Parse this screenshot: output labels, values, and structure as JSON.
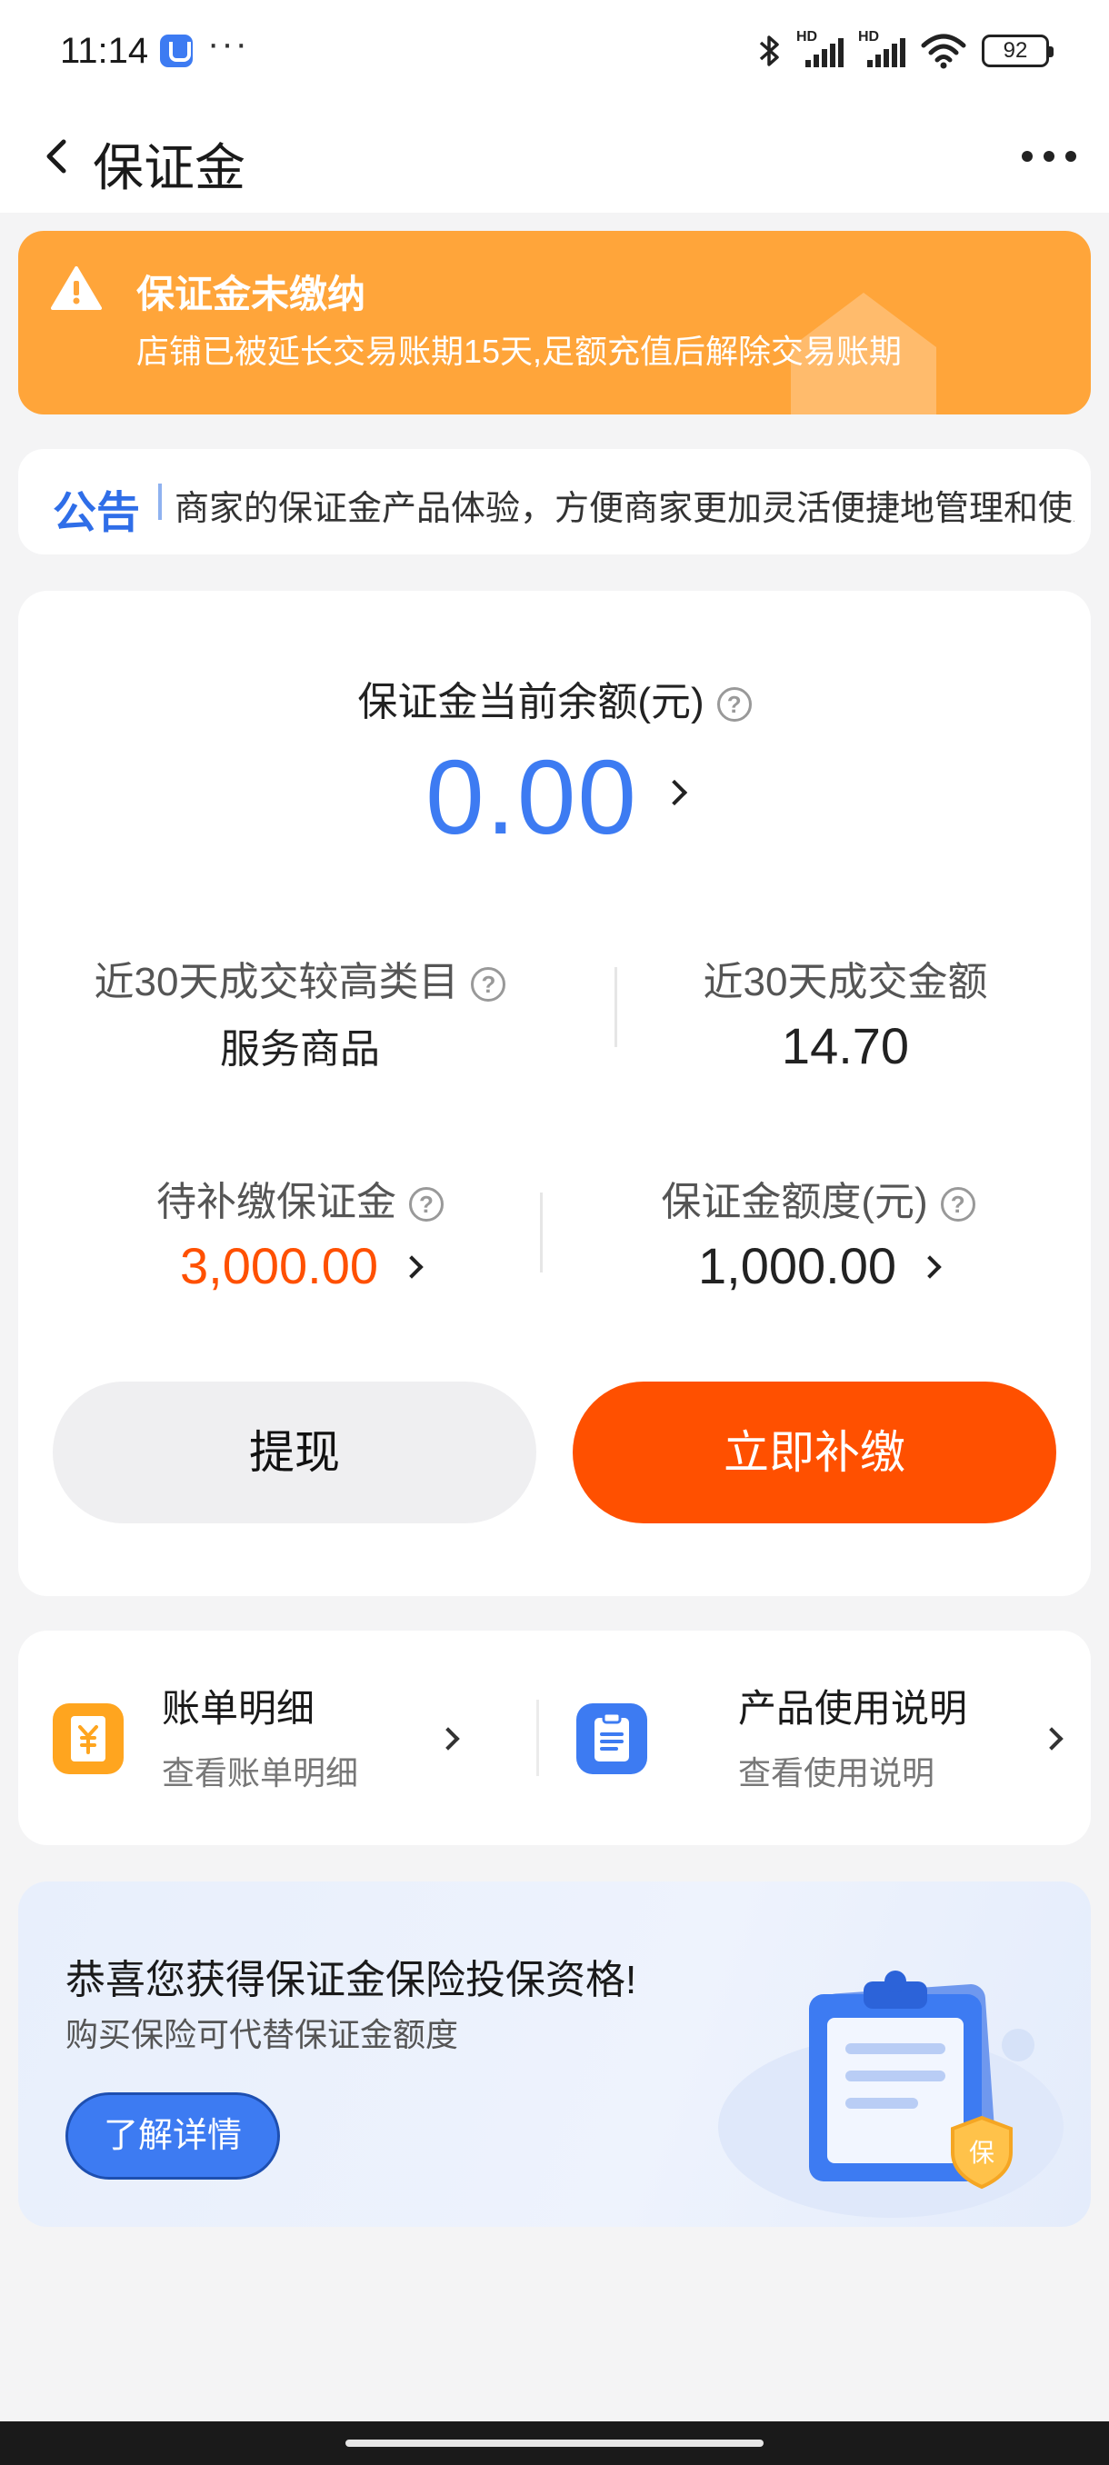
{
  "status_bar": {
    "time": "11:14",
    "more": "···",
    "hd_label": "HD",
    "battery": "92"
  },
  "nav": {
    "title": "保证金"
  },
  "warning": {
    "title": "保证金未缴纳",
    "description": "店铺已被延长交易账期15天,足额充值后解除交易账期",
    "color": "#ffa53a"
  },
  "notice": {
    "label": "公告",
    "text": "商家的保证金产品体验，方便商家更加灵活便捷地管理和使用"
  },
  "balance": {
    "label": "保证金当前余额(元)",
    "value": "0.00"
  },
  "stats": {
    "top_category_label": "近30天成交较高类目",
    "top_category_value": "服务商品",
    "deal_amount_label": "近30天成交金额",
    "deal_amount_value": "14.70",
    "pending_label": "待补缴保证金",
    "pending_value": "3,000.00",
    "quota_label": "保证金额度(元)",
    "quota_value": "1,000.00"
  },
  "buttons": {
    "withdraw": "提现",
    "pay_now": "立即补缴"
  },
  "links": [
    {
      "title": "账单明细",
      "subtitle": "查看账单明细",
      "icon": "bill-icon"
    },
    {
      "title": "产品使用说明",
      "subtitle": "查看使用说明",
      "icon": "document-icon"
    }
  ],
  "insurance": {
    "title": "恭喜您获得保证金保险投保资格!",
    "subtitle": "购买保险可代替保证金额度",
    "button": "了解详情",
    "shield_text": "保"
  },
  "colors": {
    "accent_blue": "#3d7bf2",
    "accent_orange": "#ff5000"
  }
}
